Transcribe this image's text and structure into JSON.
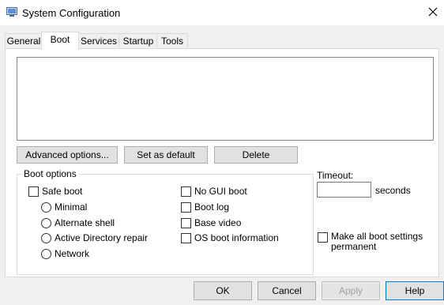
{
  "window": {
    "title": "System Configuration"
  },
  "tabs": [
    "General",
    "Boot",
    "Services",
    "Startup",
    "Tools"
  ],
  "active_tab": "Boot",
  "os_list": [],
  "buttons": {
    "advanced": "Advanced options...",
    "set_default": "Set as default",
    "delete": "Delete"
  },
  "boot_options": {
    "label": "Boot options",
    "safe_boot": "Safe boot",
    "minimal": "Minimal",
    "alternate_shell": "Alternate shell",
    "active_directory_repair": "Active Directory repair",
    "network": "Network",
    "no_gui_boot": "No GUI boot",
    "boot_log": "Boot log",
    "base_video": "Base video",
    "os_boot_info": "OS boot information"
  },
  "timeout": {
    "label": "Timeout:",
    "value": "",
    "unit": "seconds"
  },
  "permanent": {
    "line1": "Make all boot settings",
    "line2": "permanent"
  },
  "footer": {
    "ok": "OK",
    "cancel": "Cancel",
    "apply": "Apply",
    "help": "Help"
  },
  "colors": {
    "accent": "#0078d7"
  }
}
